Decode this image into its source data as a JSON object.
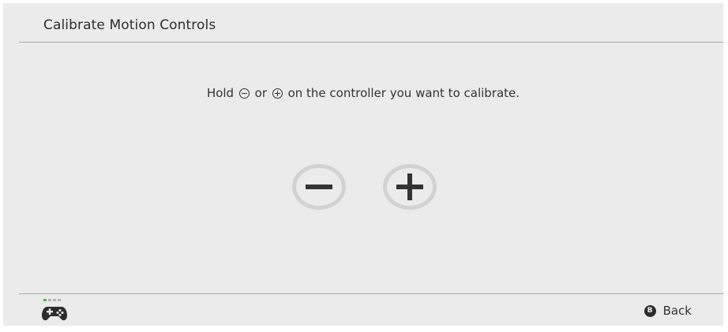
{
  "header": {
    "title": "Calibrate Motion Controls"
  },
  "main": {
    "instruction_before": "Hold",
    "instruction_between": "or",
    "instruction_after": "on the controller you want to calibrate.",
    "buttons": [
      {
        "name": "minus",
        "icon": "minus-icon"
      },
      {
        "name": "plus",
        "icon": "plus-icon"
      }
    ]
  },
  "footer": {
    "controller_icon": "gamepad-icon",
    "player_indicator": {
      "total": 4,
      "active": 1
    },
    "back_button": {
      "glyph": "B",
      "label": "Back"
    }
  },
  "colors": {
    "background": "#ebebeb",
    "text": "#2d2d2d",
    "divider": "#a9a9a9",
    "button_ring": "#d2d2d2",
    "led_active": "#39c33e",
    "led_inactive": "#b5b5b5"
  }
}
